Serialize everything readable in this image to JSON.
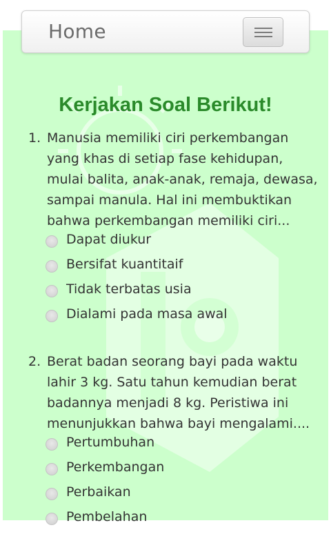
{
  "navbar": {
    "title": "Home",
    "menu_icon": "hamburger-icon"
  },
  "page": {
    "title": "Kerjakan Soal Berikut!"
  },
  "questions": [
    {
      "number": "1.",
      "lines": [
        "Manusia memiliki ciri perkembangan",
        "yang khas di setiap fase kehidupan,",
        "mulai balita, anak-anak, remaja, dewasa,",
        "sampai manula. Hal ini membuktikan",
        "bahwa perkembangan memiliki ciri..."
      ],
      "options": [
        "Dapat diukur",
        "Bersifat kuantitaif",
        "Tidak terbatas usia",
        "Dialami pada masa awal"
      ]
    },
    {
      "number": "2.",
      "lines": [
        "Berat badan seorang bayi pada waktu",
        "lahir 3 kg. Satu tahun kemudian berat",
        "badannya menjadi 8 kg. Peristiwa ini",
        "menunjukkan bahwa bayi mengalami...."
      ],
      "options": [
        "Pertumbuhan",
        "Perkembangan",
        "Perbaikan",
        "Pembelahan"
      ]
    }
  ],
  "colors": {
    "panel": "#ccffcc",
    "title": "#2a8a2a",
    "text": "#333333"
  }
}
